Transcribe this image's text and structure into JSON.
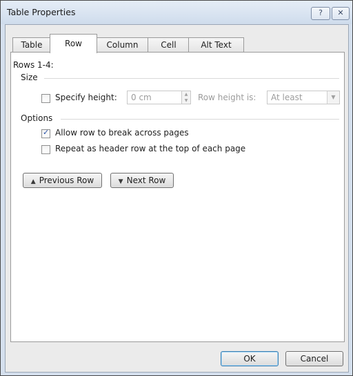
{
  "window": {
    "title": "Table Properties",
    "help_glyph": "?",
    "close_glyph": "✕"
  },
  "tabs": [
    {
      "label": "Table",
      "key": "T",
      "active": false
    },
    {
      "label": "Row",
      "key": "R",
      "active": true
    },
    {
      "label": "Column",
      "key": "u",
      "active": false
    },
    {
      "label": "Cell",
      "key": "e",
      "active": false
    },
    {
      "label": "Alt Text",
      "key": "A",
      "active": false
    }
  ],
  "row_tab": {
    "rows_label": "Rows 1-4:",
    "size_heading": "Size",
    "specify_height": {
      "label": "Specify height:",
      "checked": false
    },
    "height_value": "0 cm",
    "row_height_is_label": "Row height is:",
    "row_height_is_value": "At least",
    "options_heading": "Options",
    "allow_break": {
      "label": "Allow row to break across pages",
      "checked": true
    },
    "repeat_header": {
      "label": "Repeat as header row at the top of each page",
      "checked": false
    },
    "previous_row_label": "Previous Row",
    "next_row_label": "Next Row"
  },
  "footer": {
    "ok_label": "OK",
    "cancel_label": "Cancel"
  }
}
